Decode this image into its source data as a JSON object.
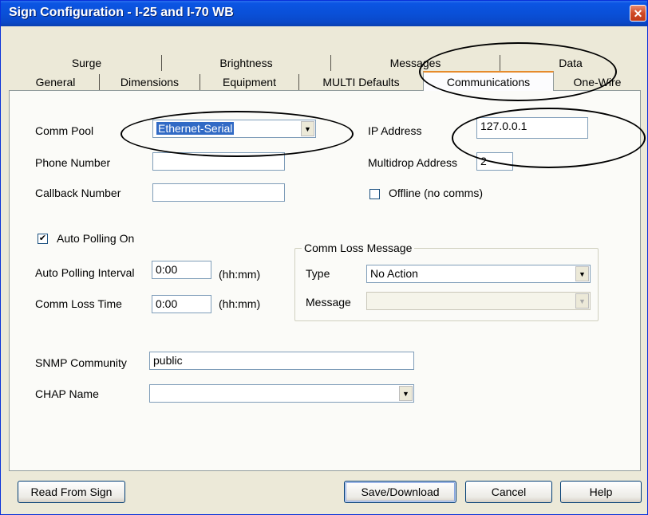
{
  "window": {
    "title": "Sign Configuration - I-25 and I-70 WB",
    "close_glyph": "✕"
  },
  "tabs": {
    "row1": [
      "Surge",
      "Brightness",
      "Messages",
      "Data"
    ],
    "row2": [
      "General",
      "Dimensions",
      "Equipment",
      "MULTI Defaults",
      "Communications",
      "One-Wire"
    ],
    "selected": "Communications"
  },
  "form": {
    "comm_pool": {
      "label": "Comm Pool",
      "value": "Ethernet-Serial"
    },
    "phone_number": {
      "label": "Phone Number",
      "value": ""
    },
    "callback_number": {
      "label": "Callback Number",
      "value": ""
    },
    "ip_address": {
      "label": "IP Address",
      "value": "127.0.0.1"
    },
    "multidrop_address": {
      "label": "Multidrop Address",
      "value": "2"
    },
    "offline": {
      "label": "Offline (no comms)",
      "checked": false
    },
    "auto_polling": {
      "label": "Auto Polling On",
      "checked": true,
      "check_glyph": "✔"
    },
    "auto_polling_interval": {
      "label": "Auto Polling Interval",
      "value": "0:00",
      "unit": "(hh:mm)"
    },
    "comm_loss_time": {
      "label": "Comm Loss Time",
      "value": "0:00",
      "unit": "(hh:mm)"
    },
    "comm_loss_message": {
      "legend": "Comm Loss Message",
      "type_label": "Type",
      "type_value": "No Action",
      "message_label": "Message",
      "message_value": ""
    },
    "snmp_community": {
      "label": "SNMP Community",
      "value": "public"
    },
    "chap_name": {
      "label": "CHAP Name",
      "value": ""
    },
    "dropdown_glyph": "▼"
  },
  "buttons": {
    "read_from_sign": "Read From Sign",
    "save_download": "Save/Download",
    "cancel": "Cancel",
    "help": "Help"
  },
  "colors": {
    "title_bar": "#0a4fd6",
    "selection": "#316ac5",
    "tab_highlight": "#e68b2c",
    "close_button": "#cf4a26"
  }
}
